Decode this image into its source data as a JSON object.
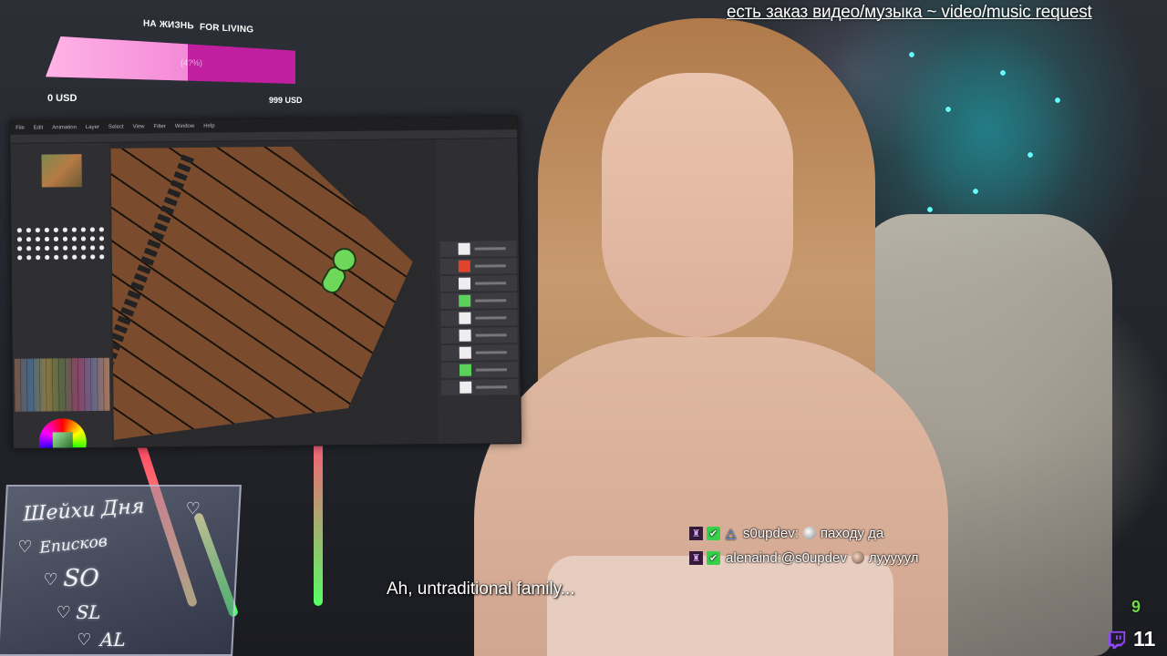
{
  "donation_goal": {
    "label_ru": "НА ЖИЗНЬ",
    "label_en": "FOR LIVING",
    "progress_text": "(4?%)",
    "min_label": "0 USD",
    "max_label": "999 USD",
    "fill_color": "#f48ad8",
    "bar_color": "#c020a0"
  },
  "ticker": {
    "text": "есть заказ видео/музыка ~ video/music request"
  },
  "paint_app": {
    "menu": [
      "File",
      "Edit",
      "Animation",
      "Layer",
      "Select",
      "View",
      "Filter",
      "Window",
      "Help"
    ],
    "layer_thumbs": [
      "white",
      "red",
      "white",
      "green",
      "white",
      "white",
      "white",
      "green",
      "white"
    ]
  },
  "sign": {
    "line1": "Шейхи Дня",
    "line2": "Еписков",
    "line3": "SO",
    "line4": "SL",
    "line5": "AL"
  },
  "chat": {
    "messages": [
      {
        "user": "s0updev:",
        "text": "паходу да",
        "badges": [
          "subscriber",
          "verified",
          "vip"
        ]
      },
      {
        "user": "alenaind:",
        "text": "@s0updev",
        "suffix": "лууууул",
        "badges": [
          "subscriber",
          "verified"
        ]
      }
    ]
  },
  "subtitle": {
    "text": "Ah, untraditional family..."
  },
  "viewers": {
    "small_count": "9",
    "big_count": "11",
    "small_color": "#6ed84a",
    "icon": "twitch-icon"
  }
}
